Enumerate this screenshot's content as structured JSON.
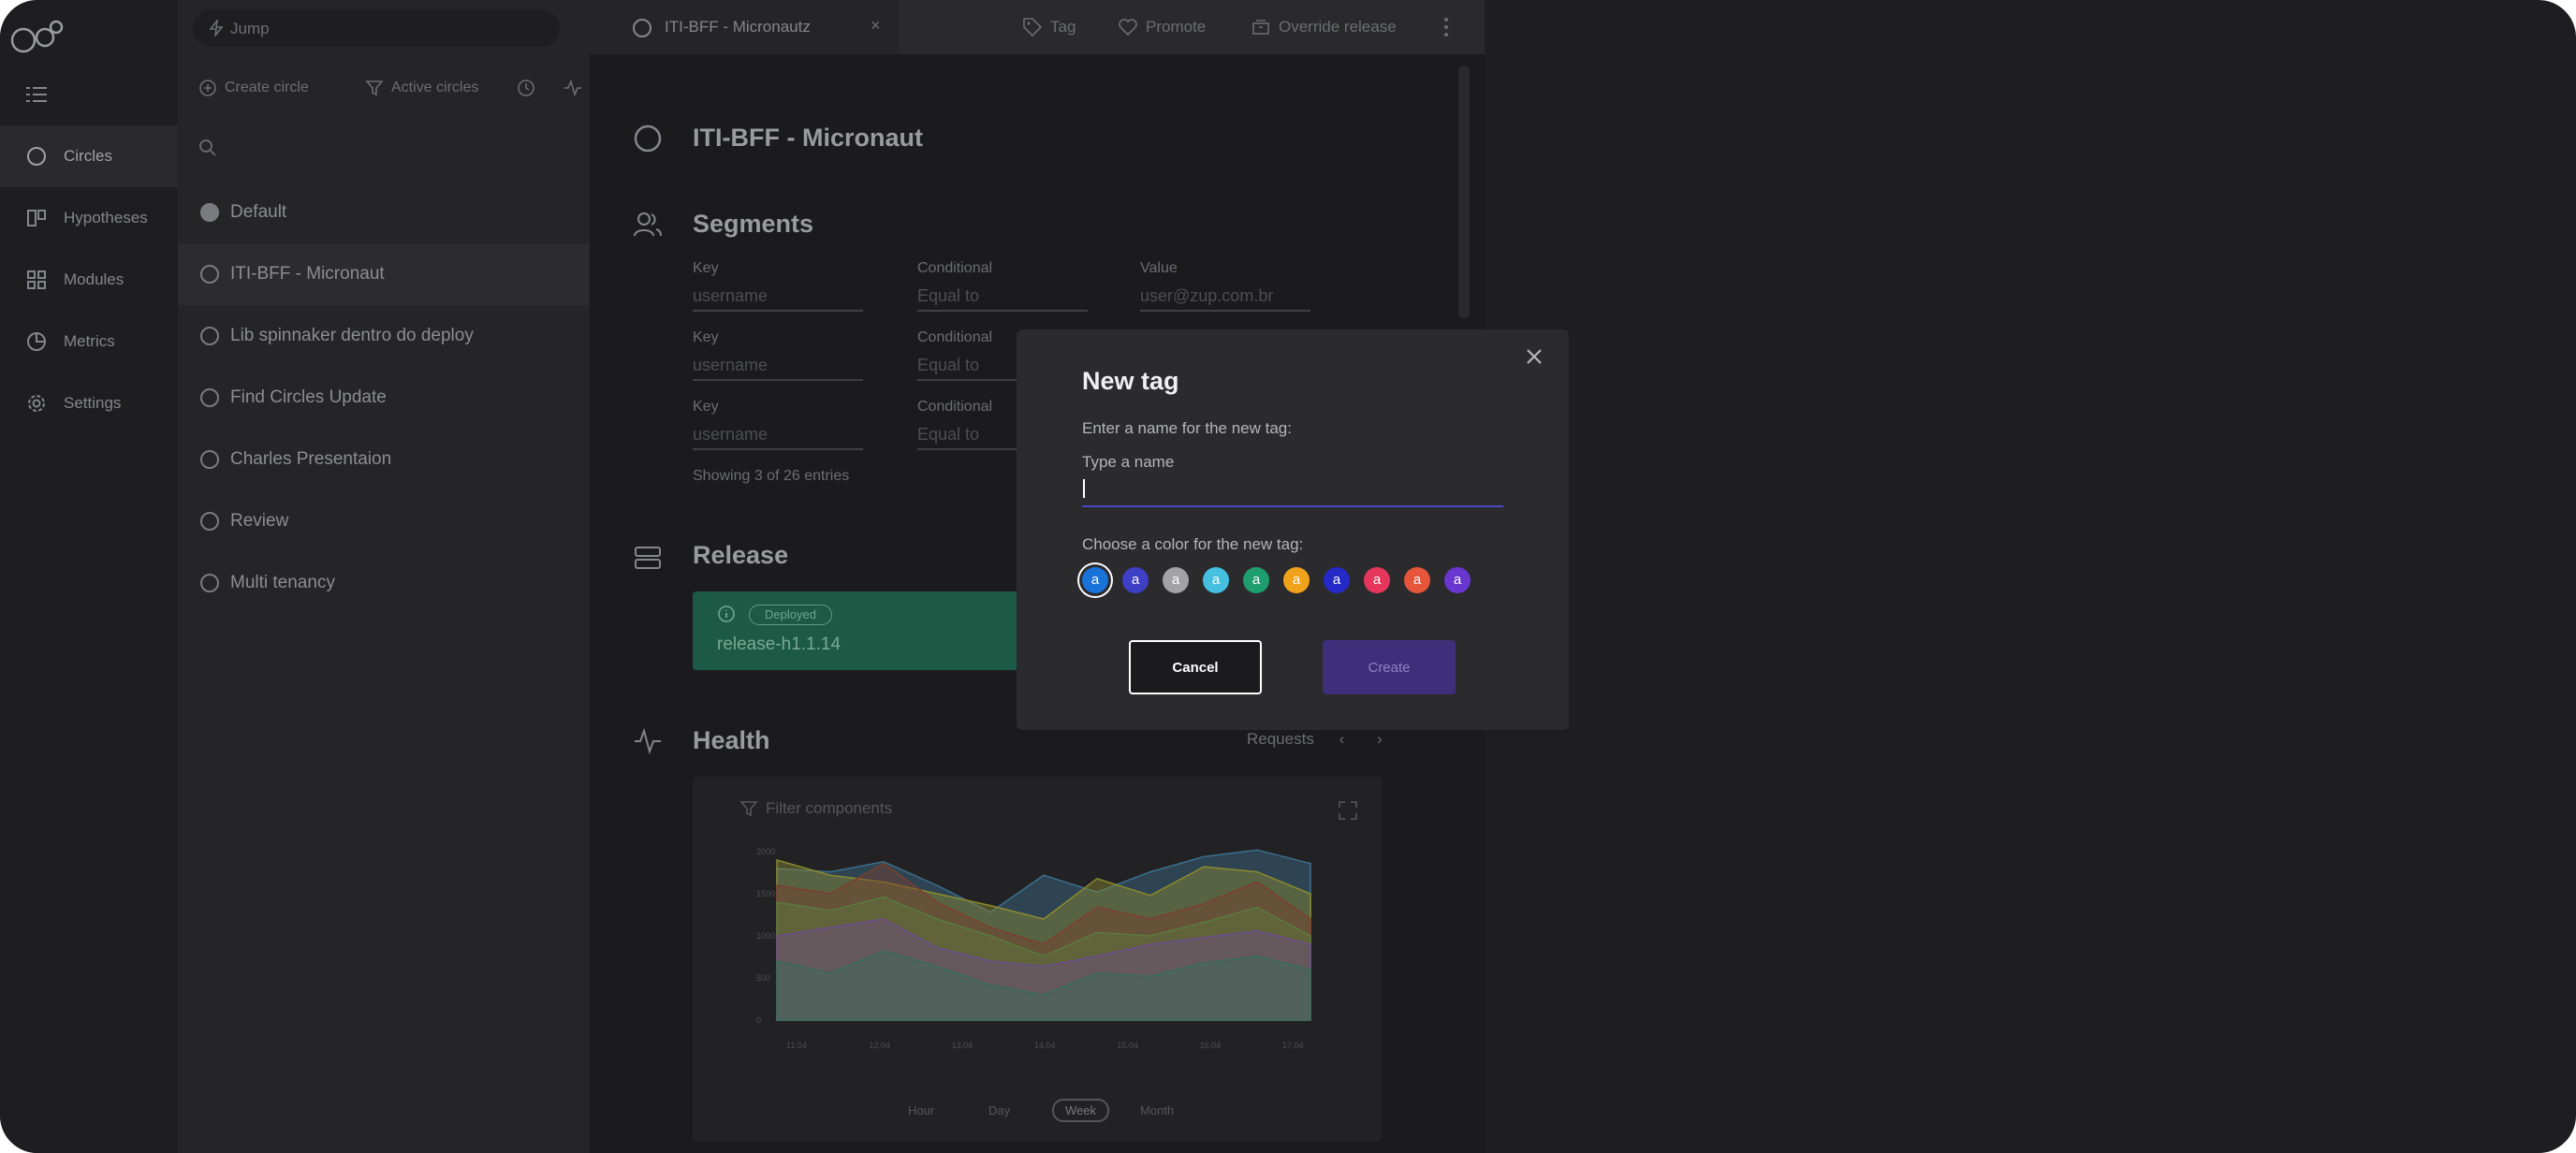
{
  "search": {
    "jump_placeholder": "Jump"
  },
  "nav": {
    "items": [
      {
        "label": "Circles",
        "icon": "circle-icon",
        "active": true
      },
      {
        "label": "Hypotheses",
        "icon": "hypotheses-icon"
      },
      {
        "label": "Modules",
        "icon": "modules-grid-icon"
      },
      {
        "label": "Metrics",
        "icon": "pie-chart-icon"
      },
      {
        "label": "Settings",
        "icon": "gear-icon"
      }
    ]
  },
  "circles_panel": {
    "create_label": "Create circle",
    "filter_label": "Active circles",
    "items": [
      {
        "label": "Default",
        "filled": true
      },
      {
        "label": "ITI-BFF - Micronaut",
        "active": true
      },
      {
        "label": "Lib spinnaker dentro do deploy"
      },
      {
        "label": "Find Circles Update"
      },
      {
        "label": "Charles Presentaion"
      },
      {
        "label": "Review"
      },
      {
        "label": "Multi tenancy"
      }
    ]
  },
  "tab": {
    "label": "ITI-BFF - Micronautz",
    "close": "×"
  },
  "actions": {
    "tag": "Tag",
    "promote": "Promote",
    "override": "Override release"
  },
  "circle": {
    "title": "ITI-BFF - Micronaut",
    "segments": {
      "title": "Segments",
      "rows": [
        {
          "key_label": "Key",
          "key": "username",
          "cond_label": "Conditional",
          "cond": "Equal to",
          "value_label": "Value",
          "value": "user@zup.com.br"
        },
        {
          "key_label": "Key",
          "key": "username",
          "cond_label": "Conditional",
          "cond": "Equal to",
          "value_label": "",
          "value": ""
        },
        {
          "key_label": "Key",
          "key": "username",
          "cond_label": "Conditional",
          "cond": "Equal to",
          "value_label": "",
          "value": ""
        }
      ],
      "showing": "Showing 3 of 26 entries"
    },
    "release": {
      "title": "Release",
      "status": "Deployed",
      "name": "release-h1.1.14"
    },
    "health": {
      "title": "Health",
      "metric": "Requests",
      "filter_placeholder": "Filter components",
      "periods": [
        "Hour",
        "Day",
        "Week",
        "Month"
      ],
      "selected_period": "Week"
    }
  },
  "chart_data": {
    "type": "area",
    "x": [
      "11.04",
      "12.04",
      "13.04",
      "14.04",
      "15.04",
      "16.04",
      "17.04"
    ],
    "y_ticks": [
      "0",
      "500",
      "1000",
      "1500",
      "2000"
    ],
    "ylim": [
      0,
      2000
    ],
    "series": [
      {
        "color": "#3d6e8c",
        "values": [
          1800,
          1760,
          1880,
          1600,
          1280,
          1720,
          1520,
          1760,
          1940,
          2020,
          1860
        ]
      },
      {
        "color": "#8a8a2e",
        "values": [
          1900,
          1720,
          1640,
          1500,
          1360,
          1200,
          1680,
          1480,
          1820,
          1760,
          1500
        ]
      },
      {
        "color": "#7b3f2e",
        "values": [
          1600,
          1500,
          1860,
          1400,
          1100,
          900,
          1340,
          1200,
          1380,
          1640,
          1200
        ]
      },
      {
        "color": "#5b7a3e",
        "values": [
          1400,
          1300,
          1460,
          1200,
          1000,
          760,
          1040,
          1000,
          1160,
          1340,
          1000
        ]
      },
      {
        "color": "#6a4b8a",
        "values": [
          1000,
          1100,
          1200,
          860,
          700,
          640,
          760,
          900,
          980,
          1060,
          900
        ]
      },
      {
        "color": "#3a6a5a",
        "values": [
          700,
          560,
          820,
          640,
          420,
          300,
          560,
          520,
          680,
          760,
          600
        ]
      }
    ]
  },
  "modal": {
    "title": "New tag",
    "name_label": "Enter a name for the new tag:",
    "input_label": "Type a name",
    "input_value": "",
    "color_label": "Choose a color for the new tag:",
    "swatch_letter": "a",
    "colors": [
      "#1872d8",
      "#3e3fc5",
      "#a3a3a6",
      "#45c0e0",
      "#1e9e6e",
      "#f0a21b",
      "#2429c7",
      "#e7365c",
      "#e6563b",
      "#6a36d0"
    ],
    "selected_color_index": 0,
    "cancel": "Cancel",
    "create": "Create"
  }
}
